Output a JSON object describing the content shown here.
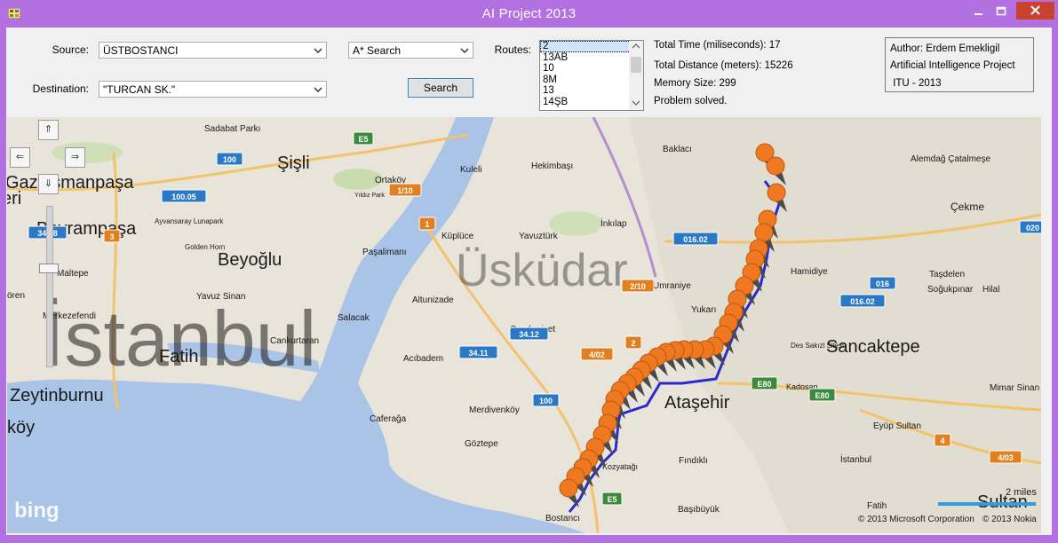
{
  "window": {
    "title": "AI Project 2013"
  },
  "form": {
    "source_label": "Source:",
    "source_value": "ÜSTBOSTANCI",
    "destination_label": "Destination:",
    "destination_value": "\"TURCAN SK.\"",
    "algorithm_value": "A* Search",
    "search_label": "Search",
    "routes_label": "Routes:",
    "routes": [
      "2",
      "13AB",
      "10",
      "8M",
      "13",
      "14ŞB"
    ],
    "selected_route": "2"
  },
  "stats": {
    "time": "Total Time (miliseconds): 17",
    "distance": "Total Distance (meters): 15226",
    "memory": "Memory Size: 299",
    "status": "Problem solved."
  },
  "info": {
    "author": "Author: Erdem Emekligil",
    "project": "Artificial Intelligence Project",
    "school": " ITU - 2013"
  },
  "map": {
    "city_label": "İstanbul",
    "district_label": "Üsküdar",
    "places": [
      "Gaziosmanpaşa",
      "Bayrampaşa",
      "Beyoğlu",
      "Şişli",
      "Fatih",
      "Zeytinburnu",
      "Sancaktepe",
      "Sultan",
      "Sadabat Parkı",
      "Ortaköy",
      "Kuleli",
      "Hekimbaşı",
      "Baklacı",
      "Alemdağ Çatalmeşe",
      "Çekme",
      "Küplüce",
      "Yavuztürk",
      "İnkılap",
      "Paşalimanı",
      "Maltepe",
      "Yavuz Sinan",
      "Merkezefendi",
      "Cankurtaran",
      "Salacak",
      "Altunizade",
      "Cumhuriyet",
      "Umraniye",
      "Hamidiye",
      "Taşdelen",
      "Soğukpınar",
      "Hilal",
      "Acıbadem",
      "Merdivenköy",
      "Caferağa",
      "Göztepe",
      "Fındıklı",
      "Başıbüyük",
      "İstanbul",
      "Fatih",
      "Mimar Sinan",
      "Eyüp Sultan",
      "Bostancı",
      "Kozyatağı",
      "Yukarı",
      "Ataşehir",
      "Kadosan",
      "Ayvansaray Lunapark",
      "Golden Horn",
      "Yıldız Park",
      "Des Sakızl Sitesi",
      "köy",
      "eri",
      "ören"
    ],
    "shields": [
      "E5",
      "100",
      "100.05",
      "1/10",
      "1",
      "3",
      "34.18",
      "016.02",
      "2/10",
      "016",
      "016.02",
      "34.12",
      "4/02",
      "2",
      "34.11",
      "100",
      "E80",
      "E80",
      "4",
      "4/03",
      "E5",
      "020"
    ],
    "scale_label": "2 miles",
    "copyright_ms": "© 2013 Microsoft Corporation",
    "copyright_nokia": "© 2013 Nokia",
    "bing_logo": "bing",
    "nav": [
      "⇑",
      "⇐",
      "⇒",
      "⇓"
    ]
  },
  "colors": {
    "title_bar": "#b270e0",
    "route_line": "#2a2ad0",
    "marker": "#f07820",
    "close_button": "#c7432e"
  }
}
